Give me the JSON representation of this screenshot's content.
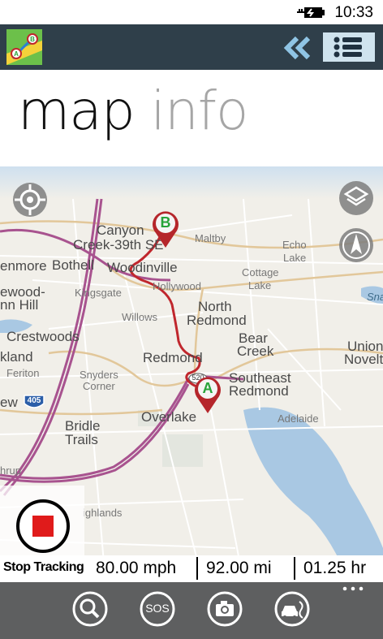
{
  "status": {
    "time": "10:33",
    "battery_icon": "battery-charging-icon"
  },
  "appbar": {
    "logo_icon": "map-route-logo-icon",
    "collapse_icon": "double-chevron-left-icon",
    "list_icon": "list-menu-icon"
  },
  "pivot": {
    "active": "map",
    "inactive": "info"
  },
  "map": {
    "labels": [
      "Canyon",
      "Creek-39th SE",
      "Maltby",
      "Echo",
      "Lake",
      "enmore",
      "Bothell",
      "Woodinville",
      "Cottage",
      "Lake",
      "Kingsgate",
      "Hollywood",
      "ewood-",
      "nn Hill",
      "North",
      "Redmond",
      "Willows",
      "Crestwoods",
      "Bear",
      "Creek",
      "Union",
      "Novelt",
      "kland",
      "Redmond",
      "Feriton",
      "Snyders",
      "Corner",
      "Southeast",
      "Redmond",
      "ew",
      "Overlake",
      "Adelaide",
      "Bridle",
      "Trails",
      "hrup",
      "ighlands",
      "Sna"
    ],
    "highway_shields": [
      "405",
      "520"
    ],
    "markers": {
      "start": "A",
      "end": "B"
    },
    "locate_icon": "locate-target-icon",
    "layers_icon": "layers-icon",
    "compass_icon": "compass-north-icon"
  },
  "tracking": {
    "stop_label": "Stop Tracking",
    "speed": "80.00 mph",
    "distance": "92.00 mi",
    "duration": "01.25 hr"
  },
  "bottombar": {
    "icons": [
      "search-icon",
      "sos-icon",
      "camera-icon",
      "car-route-icon"
    ],
    "sos_label": "SOS",
    "more_icon": "more-dots-icon"
  },
  "colors": {
    "appbar": "#2f3f4a",
    "route": "#c0272d",
    "marker_letter": "#27a33a",
    "stop_red": "#e01b1b",
    "highway_purple": "#a8538f",
    "bottombar": "#5e5f60",
    "water": "#a9c8e3"
  }
}
